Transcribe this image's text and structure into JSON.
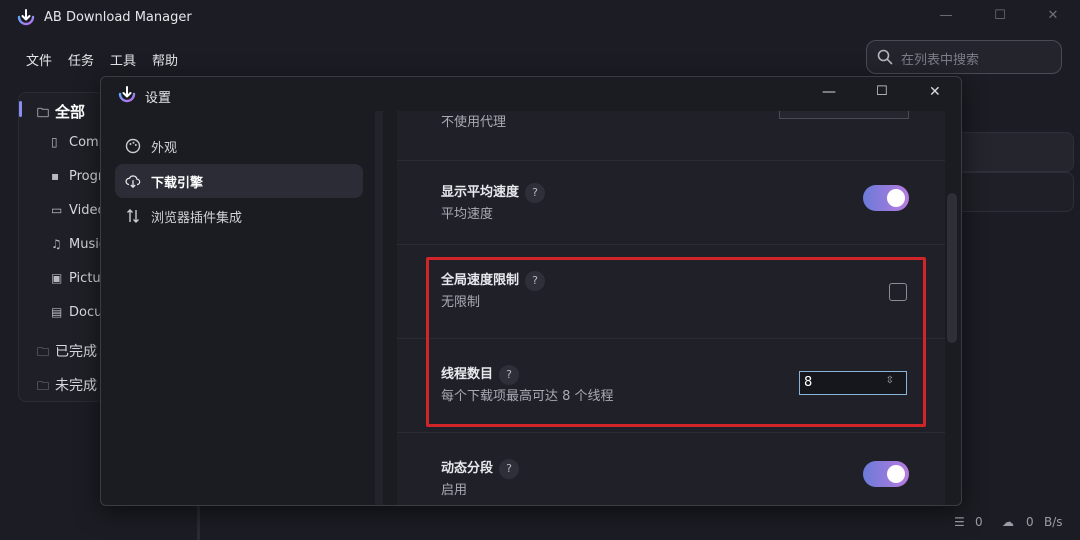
{
  "app": {
    "title": "AB Download Manager"
  },
  "window_controls": {
    "minimize": "—",
    "maximize": "☐",
    "close": "✕"
  },
  "menu": [
    "文件",
    "任务",
    "工具",
    "帮助"
  ],
  "search": {
    "placeholder": "在列表中搜索"
  },
  "categories": [
    {
      "label": "全部",
      "icon": "folder-icon",
      "active": true
    },
    {
      "label": "Comp",
      "icon": "archive-icon"
    },
    {
      "label": "Progr",
      "icon": "apps-icon"
    },
    {
      "label": "Video",
      "icon": "video-icon"
    },
    {
      "label": "Music",
      "icon": "music-icon"
    },
    {
      "label": "Pictu",
      "icon": "picture-icon"
    },
    {
      "label": "Docu",
      "icon": "document-icon"
    },
    {
      "label": "已完成",
      "icon": "folder-icon"
    },
    {
      "label": "未完成",
      "icon": "folder-icon"
    }
  ],
  "statusbar": {
    "queue_count": "0",
    "speed_value": "0",
    "speed_unit": "B/s"
  },
  "dialog": {
    "title": "设置",
    "nav": [
      {
        "label": "外观",
        "icon": "palette-icon",
        "active": false
      },
      {
        "label": "下载引擎",
        "icon": "cloud-download-icon",
        "active": true
      },
      {
        "label": "浏览器插件集成",
        "icon": "arrows-updown-icon",
        "active": false
      }
    ],
    "settings": {
      "proxy_desc": "不使用代理",
      "avg_speed": {
        "title": "显示平均速度",
        "desc": "平均速度",
        "enabled": true
      },
      "global_limit": {
        "title": "全局速度限制",
        "desc": "无限制",
        "checked": false
      },
      "threads": {
        "title": "线程数目",
        "desc": "每个下载项最高可达 8 个线程",
        "value": "8"
      },
      "dynamic_seg": {
        "title": "动态分段",
        "desc": "启用",
        "enabled": true
      }
    },
    "help_mark": "?"
  },
  "colors": {
    "accent_start": "#6a7bd8",
    "accent_end": "#b77be0",
    "highlight": "#d1252a"
  }
}
